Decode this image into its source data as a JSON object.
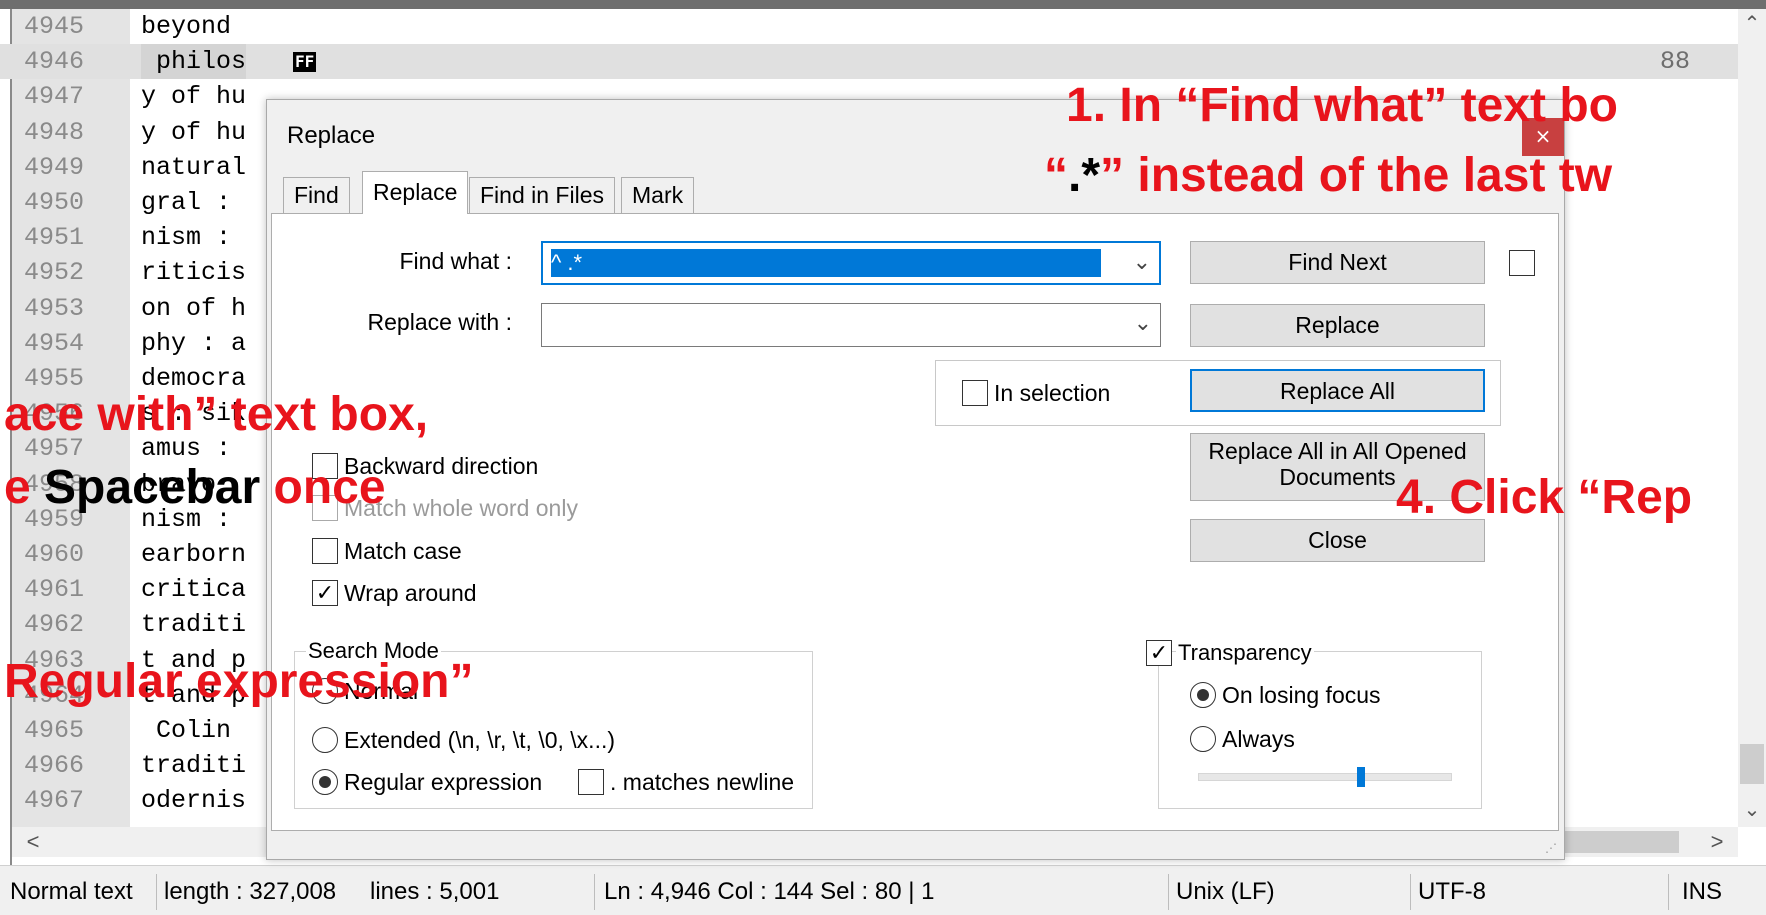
{
  "editor": {
    "lines": [
      {
        "num": "4945",
        "text": "beyond"
      },
      {
        "num": "4946",
        "text": " philos"
      },
      {
        "num": "4947",
        "text": "y of hu"
      },
      {
        "num": "4948",
        "text": "y of hu"
      },
      {
        "num": "4949",
        "text": "natural"
      },
      {
        "num": "4950",
        "text": "gral :"
      },
      {
        "num": "4951",
        "text": "nism :"
      },
      {
        "num": "4952",
        "text": "riticis"
      },
      {
        "num": "4953",
        "text": "on of h"
      },
      {
        "num": "4954",
        "text": "phy : a"
      },
      {
        "num": "4955",
        "text": "democra"
      },
      {
        "num": "4956",
        "text": "s : sik"
      },
      {
        "num": "4957",
        "text": "amus :"
      },
      {
        "num": "4958",
        "text": "bravo"
      },
      {
        "num": "4959",
        "text": "nism :"
      },
      {
        "num": "4960",
        "text": "earborn"
      },
      {
        "num": "4961",
        "text": "critica"
      },
      {
        "num": "4962",
        "text": "traditi"
      },
      {
        "num": "4963",
        "text": "t and p"
      },
      {
        "num": "4964",
        "text": "t and p"
      },
      {
        "num": "4965",
        "text": " Colin"
      },
      {
        "num": "4966",
        "text": "traditi"
      },
      {
        "num": "4967",
        "text": "odernis"
      }
    ],
    "ff_marker": "FF",
    "column_marker": "88",
    "scroll_up": "⌃",
    "scroll_down": "⌄",
    "scroll_left": "<",
    "scroll_right": ">"
  },
  "status_bar": {
    "type": "Normal text",
    "length": "length : 327,008",
    "lines": "lines : 5,001",
    "position": "Ln : 4,946    Col : 144    Sel : 80 | 1",
    "eol": "Unix (LF)",
    "encoding": "UTF-8",
    "mode": "INS"
  },
  "dialog": {
    "title": "Replace",
    "close": "×",
    "tabs": [
      "Find",
      "Replace",
      "Find in Files",
      "Mark"
    ],
    "active_tab": "Replace",
    "find_what_label": "Find what :",
    "find_what_value": "^                                                           .*",
    "replace_with_label": "Replace with :",
    "replace_with_value": "",
    "buttons": {
      "find_next": "Find Next",
      "replace": "Replace",
      "replace_all": "Replace All",
      "replace_all_opened": "Replace All in All Opened Documents",
      "close": "Close"
    },
    "in_selection": "In selection",
    "options": {
      "backward_direction": "Backward direction",
      "match_whole_word": "Match whole word only",
      "match_case": "Match case",
      "wrap_around": "Wrap around"
    },
    "search_mode": {
      "label": "Search Mode",
      "normal": "Normal",
      "extended": "Extended (\\n, \\r, \\t, \\0, \\x...)",
      "regex": "Regular expression",
      "matches_newline": ". matches newline",
      "selected": "regex"
    },
    "transparency": {
      "label": "Transparency",
      "on_losing_focus": "On losing focus",
      "always": "Always",
      "selected": "on_losing_focus",
      "level": 0.64
    },
    "check_mark": "✓",
    "dropdown_icon": "⌄"
  },
  "overlays": {
    "step1_line1": "1. In “Find what” text bo",
    "step1_line2_q1": "“",
    "step1_line2_dotstar": ".*",
    "step1_line2_rest": "” instead of the last tw",
    "step2_line1": "ace with” text box,",
    "step2_line2_pre": "e ",
    "step2_line2_key": "Spacebar",
    "step2_line2_post": " once",
    "step3": "Regular expression”",
    "step4": "4. Click “Rep"
  },
  "colors": {
    "annotation_red": "#e8141c",
    "selection_blue": "#0078d7",
    "gutter_gray": "#e4e4e4"
  }
}
